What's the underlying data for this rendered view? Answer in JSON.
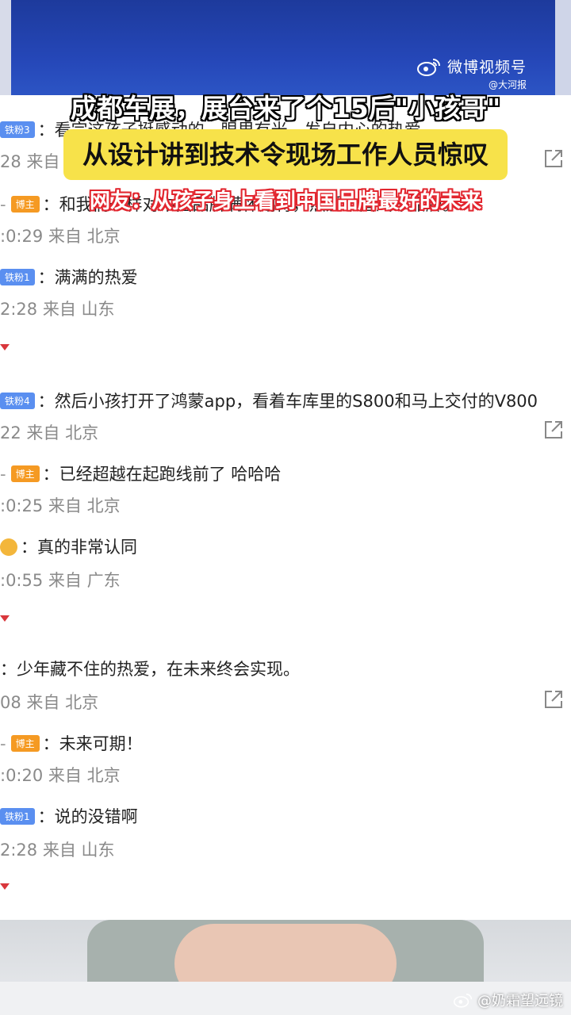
{
  "banner": {
    "platform_label": "微博视频号",
    "source": "@大河报"
  },
  "headline": {
    "line1": "成都车展，展台来了个15后\"小孩哥\"",
    "line2": "从设计讲到技术令现场工作人员惊叹",
    "line3": "网友：从孩子身上看到中国品牌最好的未来"
  },
  "comments": [
    {
      "badge": "",
      "text": "：看完这孩子挺感动的，眼里有光，发自内心的热爱",
      "meta": "28 来自 北京",
      "share": true
    },
    {
      "badge": "博主",
      "text": "：和我们一样对中国品牌满怀期待，热爱中国汽车品牌。",
      "meta": ":0:29 来自 北京"
    },
    {
      "badge": "铁粉1",
      "text": "：满满的热爱",
      "meta": "2:28 来自 山东"
    },
    {
      "badge": "铁粉4",
      "text": "：然后小孩打开了鸿蒙app，看着车库里的S800和马上交付的V800",
      "meta": "22 来自 北京",
      "share": true
    },
    {
      "badge": "博主",
      "text": "：已经超越在起跑线前了 哈哈哈",
      "meta": ":0:25 来自 北京"
    },
    {
      "badge": "",
      "text": "：真的非常认同",
      "meta": ":0:55 来自 广东"
    },
    {
      "badge": "",
      "text": "：少年藏不住的热爱，在未来终会实现。",
      "meta": "08 来自 北京",
      "share": true
    },
    {
      "badge": "博主",
      "text": "：未来可期！",
      "meta": ":0:20 来自 北京"
    },
    {
      "badge": "铁粉1",
      "text": "：说的没错啊",
      "meta": "2:28 来自 山东"
    }
  ],
  "watermark": "@奶霜望远镜",
  "colors": {
    "banner_blue": "#2547b8",
    "headline_yellow": "#f7e24a",
    "headline_red": "#e2262f",
    "badge_orange": "#f59a23",
    "badge_blue": "#5a8ff0"
  }
}
